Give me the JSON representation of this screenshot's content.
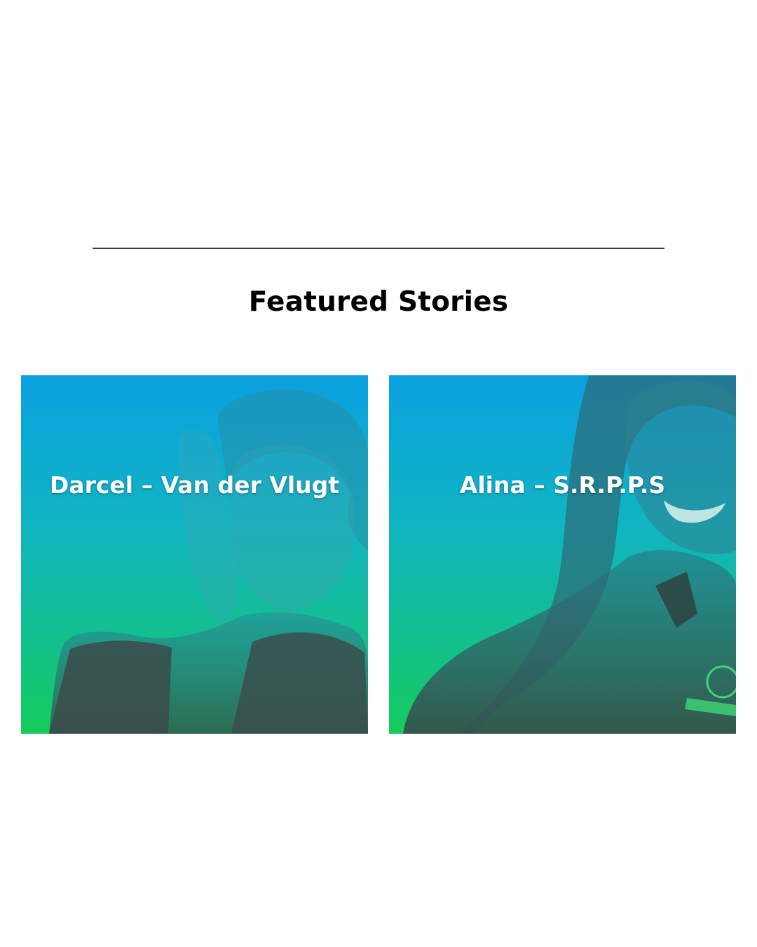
{
  "section": {
    "title": "Featured Stories"
  },
  "stories": [
    {
      "label": "Darcel – Van der Vlugt",
      "icon": "portrait-photo"
    },
    {
      "label": "Alina – S.R.P.P.S",
      "icon": "portrait-photo"
    }
  ],
  "colors": {
    "gradient_top": "#0aa0e0",
    "gradient_bottom": "#16cc5c",
    "silhouette": "#3d5a55",
    "divider": "#3a3a3a"
  }
}
